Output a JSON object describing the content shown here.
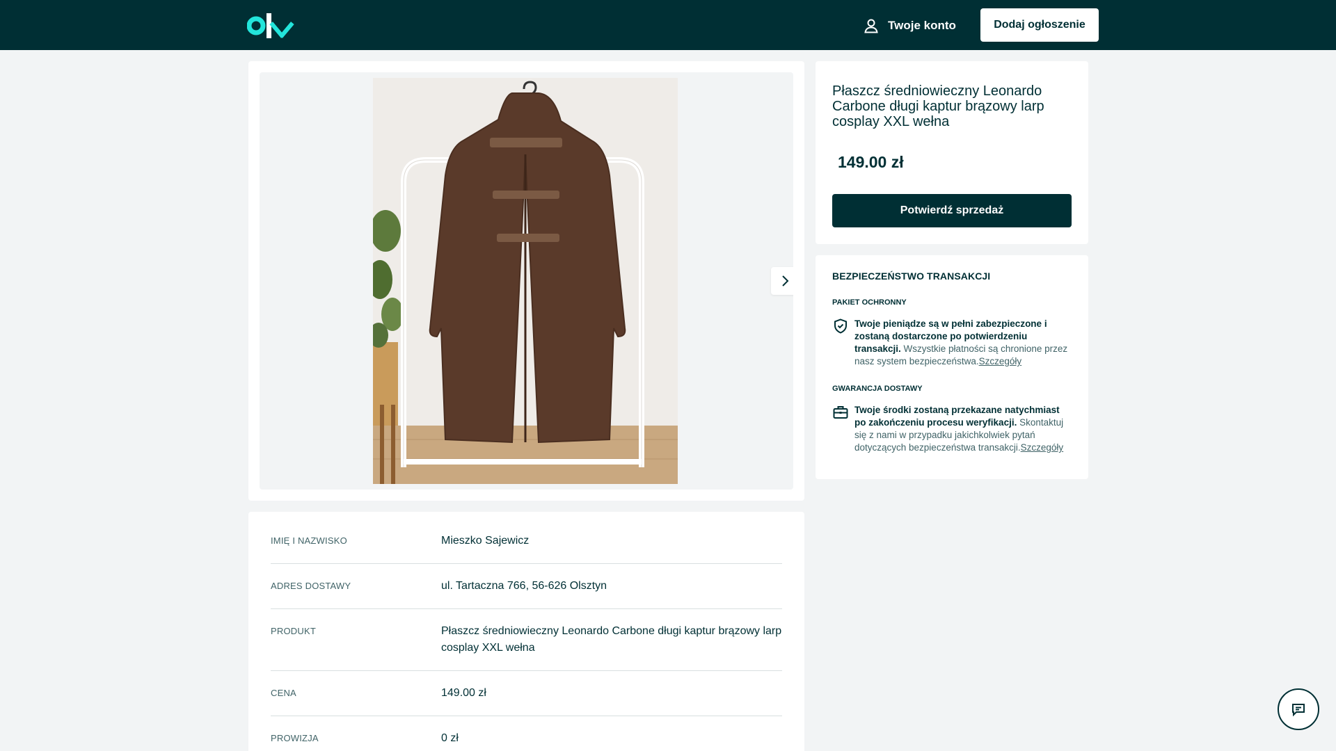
{
  "header": {
    "logo_text": "olx",
    "account_label": "Twoje konto",
    "add_button_label": "Dodaj ogłoszenie"
  },
  "gallery": {
    "image_alt": "Brązowy płaszcz z kapturem na wieszaku"
  },
  "listing": {
    "title": "Płaszcz średniowieczny Leonardo Carbone długi kaptur brązowy larp cosplay XXL wełna",
    "price": "149.00 zł",
    "confirm_button": "Potwierdź sprzedaż"
  },
  "safety": {
    "heading": "BEZPIECZEŃSTWO TRANSAKCJI",
    "section1_title": "PAKIET OCHRONNY",
    "section1_bold": "Twoje pieniądze są w pełni zabezpieczone i zostaną dostarczone po potwierdzeniu transakcji.",
    "section1_text": " Wszystkie płatności są chronione przez nasz system bezpieczeństwa.",
    "section1_link": "Szczegóły",
    "section2_title": "GWARANCJA DOSTAWY",
    "section2_bold": "Twoje środki zostaną przekazane natychmiast po zakończeniu procesu weryfikacji.",
    "section2_text": " Skontaktuj się z nami w przypadku jakichkolwiek pytań dotyczących bezpieczeństwa transakcji.",
    "section2_link": "Szczegóły"
  },
  "details": {
    "rows": [
      {
        "label": "IMIĘ I NAZWISKO",
        "value": "Mieszko Sajewicz"
      },
      {
        "label": "ADRES DOSTAWY",
        "value": "ul. Tartaczna 766, 56-626 Olsztyn"
      },
      {
        "label": "PRODUKT",
        "value": "Płaszcz średniowieczny Leonardo Carbone długi kaptur brązowy larp cosplay XXL wełna"
      },
      {
        "label": "CENA",
        "value": "149.00 zł"
      },
      {
        "label": "PROWIZJA",
        "value": "0 zł"
      }
    ]
  },
  "colors": {
    "brand_dark": "#002f34",
    "brand_teal": "#23e5db",
    "background": "#f2f4f5"
  }
}
